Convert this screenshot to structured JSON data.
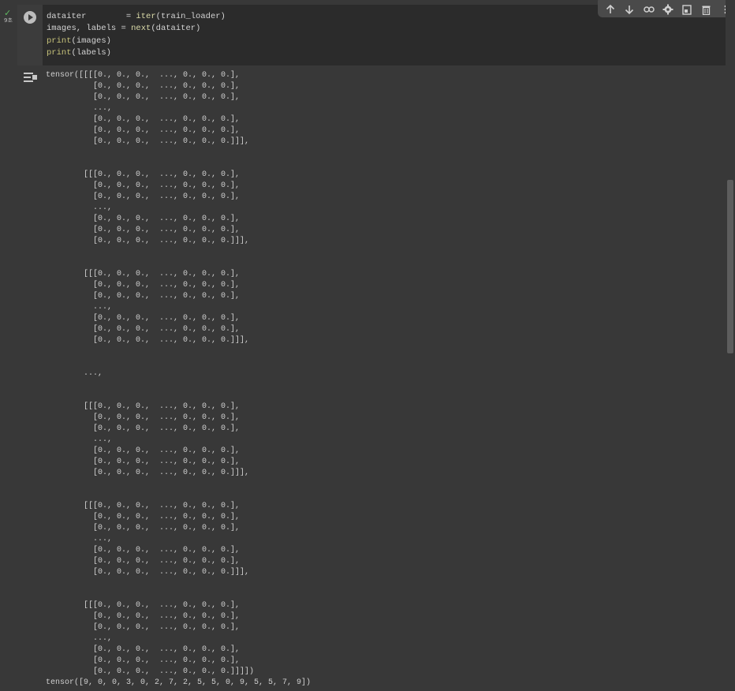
{
  "cell": {
    "exec_time": "9초",
    "code_lines": [
      {
        "parts": [
          {
            "t": "dataiter        = "
          },
          {
            "t": "iter",
            "c": "fn"
          },
          {
            "t": "(train_loader)"
          }
        ]
      },
      {
        "parts": [
          {
            "t": "images, labels = "
          },
          {
            "t": "next",
            "c": "fn"
          },
          {
            "t": "(dataiter)"
          }
        ]
      },
      {
        "parts": [
          {
            "t": "print",
            "c": "bi"
          },
          {
            "t": "(images)"
          }
        ]
      },
      {
        "parts": [
          {
            "t": "print",
            "c": "bi"
          },
          {
            "t": "(labels)"
          }
        ]
      }
    ]
  },
  "output": {
    "text": "tensor([[[[0., 0., 0.,  ..., 0., 0., 0.],\n          [0., 0., 0.,  ..., 0., 0., 0.],\n          [0., 0., 0.,  ..., 0., 0., 0.],\n          ...,\n          [0., 0., 0.,  ..., 0., 0., 0.],\n          [0., 0., 0.,  ..., 0., 0., 0.],\n          [0., 0., 0.,  ..., 0., 0., 0.]]],\n\n\n        [[[0., 0., 0.,  ..., 0., 0., 0.],\n          [0., 0., 0.,  ..., 0., 0., 0.],\n          [0., 0., 0.,  ..., 0., 0., 0.],\n          ...,\n          [0., 0., 0.,  ..., 0., 0., 0.],\n          [0., 0., 0.,  ..., 0., 0., 0.],\n          [0., 0., 0.,  ..., 0., 0., 0.]]],\n\n\n        [[[0., 0., 0.,  ..., 0., 0., 0.],\n          [0., 0., 0.,  ..., 0., 0., 0.],\n          [0., 0., 0.,  ..., 0., 0., 0.],\n          ...,\n          [0., 0., 0.,  ..., 0., 0., 0.],\n          [0., 0., 0.,  ..., 0., 0., 0.],\n          [0., 0., 0.,  ..., 0., 0., 0.]]],\n\n\n        ...,\n\n\n        [[[0., 0., 0.,  ..., 0., 0., 0.],\n          [0., 0., 0.,  ..., 0., 0., 0.],\n          [0., 0., 0.,  ..., 0., 0., 0.],\n          ...,\n          [0., 0., 0.,  ..., 0., 0., 0.],\n          [0., 0., 0.,  ..., 0., 0., 0.],\n          [0., 0., 0.,  ..., 0., 0., 0.]]],\n\n\n        [[[0., 0., 0.,  ..., 0., 0., 0.],\n          [0., 0., 0.,  ..., 0., 0., 0.],\n          [0., 0., 0.,  ..., 0., 0., 0.],\n          ...,\n          [0., 0., 0.,  ..., 0., 0., 0.],\n          [0., 0., 0.,  ..., 0., 0., 0.],\n          [0., 0., 0.,  ..., 0., 0., 0.]]],\n\n\n        [[[0., 0., 0.,  ..., 0., 0., 0.],\n          [0., 0., 0.,  ..., 0., 0., 0.],\n          [0., 0., 0.,  ..., 0., 0., 0.],\n          ...,\n          [0., 0., 0.,  ..., 0., 0., 0.],\n          [0., 0., 0.,  ..., 0., 0., 0.],\n          [0., 0., 0.,  ..., 0., 0., 0.]]]])\ntensor([9, 0, 0, 3, 0, 2, 7, 2, 5, 5, 0, 9, 5, 5, 7, 9])"
  },
  "toolbar": {
    "icons": [
      "move-up-icon",
      "move-down-icon",
      "link-icon",
      "gear-icon",
      "mirror-cell-icon",
      "trash-icon",
      "more-vert-icon"
    ]
  },
  "colors": {
    "code_bg": "#2b2b2b",
    "output_bg": "#383838",
    "function_color": "#dcdcaa",
    "builtin_color": "#c6c27a",
    "success_check": "#5fb760"
  }
}
